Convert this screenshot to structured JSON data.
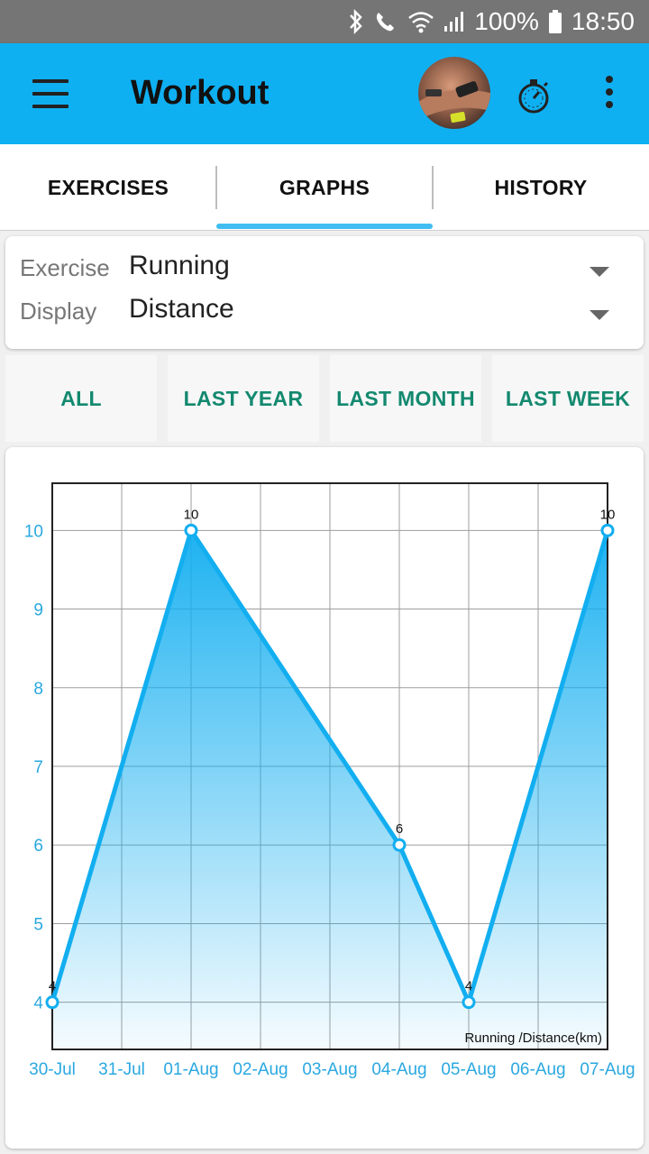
{
  "status_bar": {
    "battery": "100%",
    "time": "18:50"
  },
  "app_bar": {
    "title": "Workout",
    "icons": [
      "menu-icon",
      "avatar",
      "stopwatch-icon",
      "overflow-menu-icon"
    ]
  },
  "tabs": [
    {
      "label": "EXERCISES",
      "active": false
    },
    {
      "label": "GRAPHS",
      "active": true
    },
    {
      "label": "HISTORY",
      "active": false
    }
  ],
  "selectors": {
    "exercise": {
      "label": "Exercise",
      "value": "Running"
    },
    "display": {
      "label": "Display",
      "value": "Distance"
    }
  },
  "range_buttons": [
    "ALL",
    "LAST YEAR",
    "LAST MONTH",
    "LAST WEEK"
  ],
  "colors": {
    "app_bar": "#0fb0f2",
    "tab_indicator": "#41bdf2",
    "range_text": "#13896f",
    "chart_line": "#12aef0",
    "axis_text": "#2aa8e0"
  },
  "chart_data": {
    "type": "area",
    "x_categories": [
      "30-Jul",
      "31-Jul",
      "01-Aug",
      "02-Aug",
      "03-Aug",
      "04-Aug",
      "05-Aug",
      "06-Aug",
      "07-Aug"
    ],
    "series": [
      {
        "name": "Running /Distance(km)",
        "points": [
          {
            "x": "30-Jul",
            "y": 4
          },
          {
            "x": "01-Aug",
            "y": 10
          },
          {
            "x": "04-Aug",
            "y": 6
          },
          {
            "x": "05-Aug",
            "y": 4
          },
          {
            "x": "07-Aug",
            "y": 10
          }
        ]
      }
    ],
    "y_ticks": [
      4,
      5,
      6,
      7,
      8,
      9,
      10
    ],
    "ylim": [
      3.4,
      10.6
    ],
    "grid": true,
    "legend_text": "Running /Distance(km)",
    "legend_position": "bottom-right"
  }
}
